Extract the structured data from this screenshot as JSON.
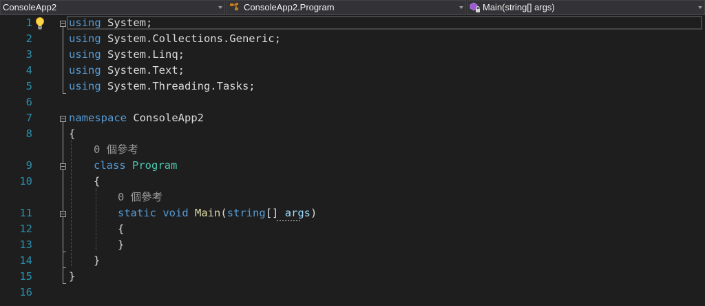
{
  "navbar": {
    "project": "ConsoleApp2",
    "class_path": "ConsoleApp2.Program",
    "member": "Main(string[] args)"
  },
  "editor": {
    "line_numbers": [
      "1",
      "2",
      "3",
      "4",
      "5",
      "6",
      "7",
      "8",
      "9",
      "10",
      "11",
      "12",
      "13",
      "14",
      "15",
      "16"
    ],
    "lines": {
      "l1": {
        "kw": "using",
        "rest": " System;"
      },
      "l2": {
        "kw": "using",
        "rest": " System.Collections.Generic;"
      },
      "l3": {
        "kw": "using",
        "rest": " System.Linq;"
      },
      "l4": {
        "kw": "using",
        "rest": " System.Text;"
      },
      "l5": {
        "kw": "using",
        "rest": " System.Threading.Tasks;"
      },
      "l7": {
        "kw": "namespace",
        "rest": " ConsoleApp2"
      },
      "l8": {
        "text": "{"
      },
      "l9": {
        "kw": "class",
        "type": "Program"
      },
      "l10": {
        "text": "{"
      },
      "l11": {
        "kw1": "static",
        "kw2": "void",
        "fn": "Main",
        "open": "(",
        "kw3": "string",
        "mid": "[] ",
        "param": "args",
        "close": ")"
      },
      "l12": {
        "text": "{"
      },
      "l13": {
        "text": "}"
      },
      "l14": {
        "text": "}"
      },
      "l15": {
        "text": "}"
      }
    },
    "codelens_class": "0 個參考",
    "codelens_main": "0 個參考"
  },
  "colors": {
    "background": "#1e1e1e",
    "keyword": "#569cd6",
    "type": "#4ec9b0",
    "method": "#dcdcaa",
    "parameter": "#9cdcfe",
    "line_number": "#2b91af",
    "plain": "#dcdcdc"
  }
}
